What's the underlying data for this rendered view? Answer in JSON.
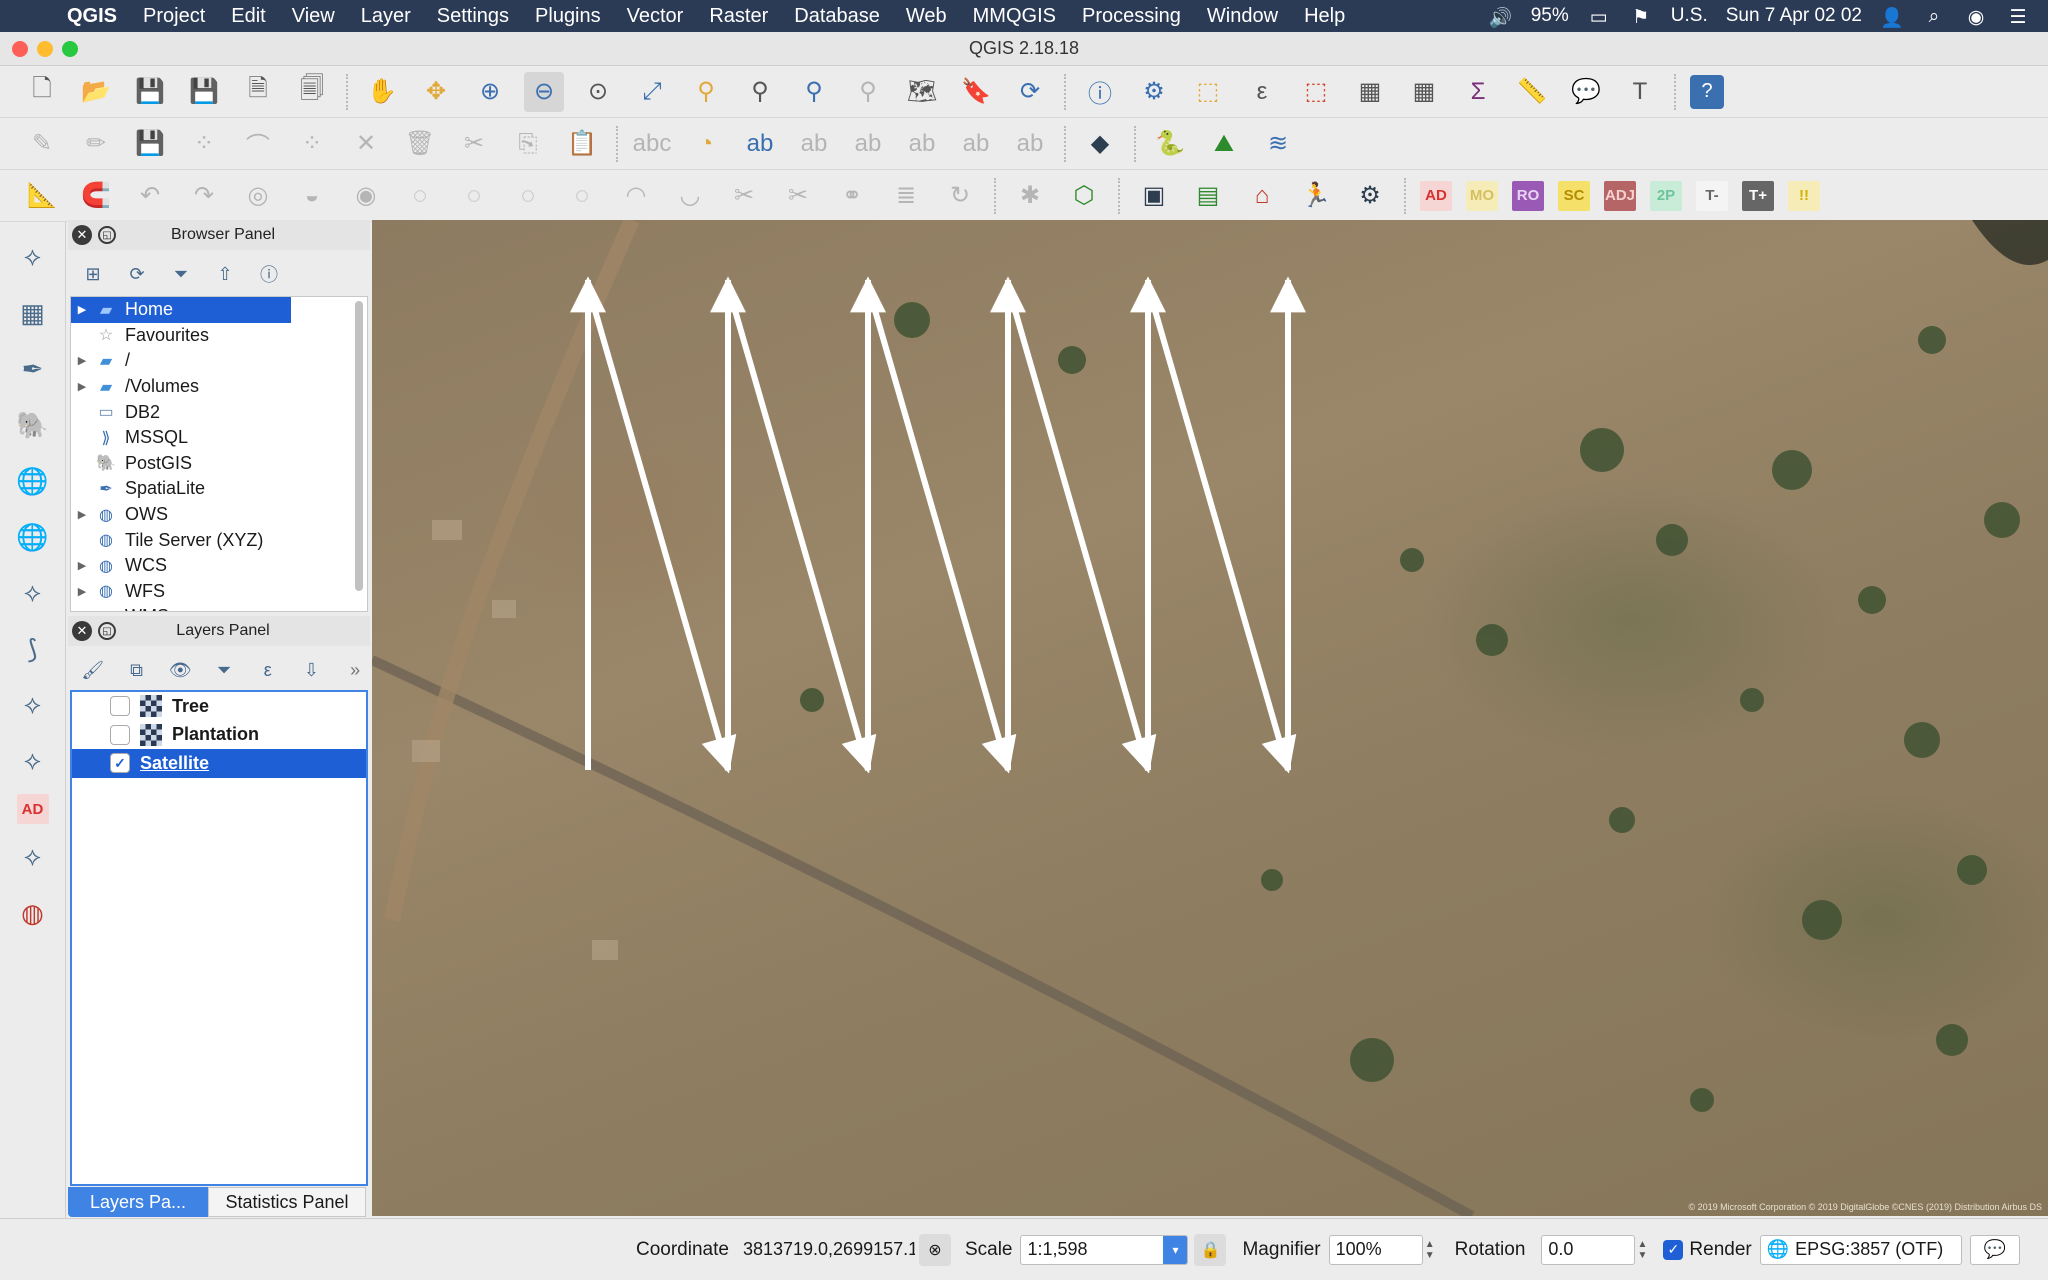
{
  "menubar": {
    "app_name": "QGIS",
    "menus": [
      "Project",
      "Edit",
      "View",
      "Layer",
      "Settings",
      "Plugins",
      "Vector",
      "Raster",
      "Database",
      "Web",
      "MMQGIS",
      "Processing",
      "Window",
      "Help"
    ],
    "battery": "95%",
    "input_source": "U.S.",
    "datetime": "Sun 7 Apr  02 02"
  },
  "window": {
    "title": "QGIS 2.18.18"
  },
  "label_toolbar": {
    "ad": "AD",
    "mo": "MO",
    "ro": "RO",
    "sc": "SC",
    "adj": "ADJ",
    "twop": "2P",
    "tminus": "T-",
    "tplus": "T+",
    "bang": "!!"
  },
  "left_toolbar": {
    "ad": "AD"
  },
  "browser_panel": {
    "title": "Browser Panel",
    "items": [
      {
        "label": "Home",
        "icon": "folder-icon",
        "expandable": true,
        "selected": true
      },
      {
        "label": "Favourites",
        "icon": "star-icon",
        "expandable": false
      },
      {
        "label": "/",
        "icon": "folder-icon",
        "expandable": true
      },
      {
        "label": "/Volumes",
        "icon": "folder-icon",
        "expandable": true
      },
      {
        "label": "DB2",
        "icon": "db2-icon",
        "expandable": false
      },
      {
        "label": "MSSQL",
        "icon": "mssql-icon",
        "expandable": false
      },
      {
        "label": "PostGIS",
        "icon": "postgis-icon",
        "expandable": false
      },
      {
        "label": "SpatiaLite",
        "icon": "spatialite-icon",
        "expandable": false
      },
      {
        "label": "OWS",
        "icon": "globe-icon",
        "expandable": true
      },
      {
        "label": "Tile Server (XYZ)",
        "icon": "globe-icon",
        "expandable": false
      },
      {
        "label": "WCS",
        "icon": "wcs-icon",
        "expandable": true
      },
      {
        "label": "WFS",
        "icon": "wfs-icon",
        "expandable": true
      },
      {
        "label": "WMS",
        "icon": "wms-icon",
        "expandable": true
      }
    ]
  },
  "layers_panel": {
    "title": "Layers Panel",
    "layers": [
      {
        "label": "Tree",
        "checked": false,
        "selected": false
      },
      {
        "label": "Plantation",
        "checked": false,
        "selected": false
      },
      {
        "label": "Satellite",
        "checked": true,
        "selected": true
      }
    ]
  },
  "panel_tabs": {
    "active": "Layers Pa...",
    "inactive": "Statistics Panel"
  },
  "map": {
    "copyright": "© 2019 Microsoft Corporation © 2019 DigitalGlobe ©CNES (2019) Distribution Airbus DS"
  },
  "statusbar": {
    "coordinate_label": "Coordinate",
    "coordinate_value": "3813719.0,2699157.1",
    "scale_label": "Scale",
    "scale_value": "1:1,598",
    "magnifier_label": "Magnifier",
    "magnifier_value": "100%",
    "rotation_label": "Rotation",
    "rotation_value": "0.0",
    "render_label": "Render",
    "crs": "EPSG:3857 (OTF)"
  },
  "colors": {
    "menubar_bg": "#2b3a55",
    "selection": "#1f5fd6",
    "tab_active": "#3f84e4",
    "flight_path": "#ffffff"
  }
}
